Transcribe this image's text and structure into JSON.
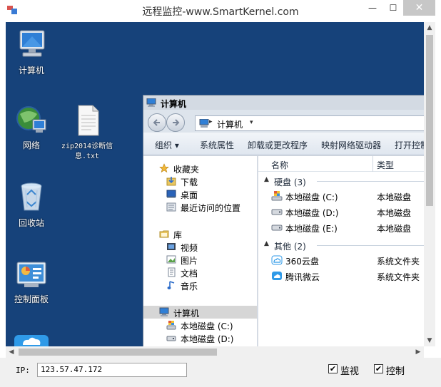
{
  "window": {
    "title": "远程监控-www.SmartKernel.com",
    "minimize_glyph": "—",
    "maximize_glyph": "☐",
    "close_glyph": "✕"
  },
  "desktop": {
    "icons": [
      {
        "label": "计算机",
        "icon": "computer-icon"
      },
      {
        "label": "网络",
        "icon": "network-icon"
      },
      {
        "label": "zip2014诊断信息.txt",
        "icon": "text-file-icon"
      },
      {
        "label": "回收站",
        "icon": "recycle-bin-icon"
      },
      {
        "label": "控制面板",
        "icon": "control-panel-icon"
      }
    ]
  },
  "explorer": {
    "title": "计算机",
    "address": "计算机",
    "toolbar": [
      "组织 ▾",
      "系统属性",
      "卸载或更改程序",
      "映射网络驱动器",
      "打开控制"
    ],
    "nav_pane": {
      "favorites": "收藏夹",
      "favorites_items": [
        "下载",
        "桌面",
        "最近访问的位置"
      ],
      "libraries": "库",
      "libraries_items": [
        "视频",
        "图片",
        "文档",
        "音乐"
      ],
      "computer": "计算机",
      "computer_items": [
        "本地磁盘 (C:)",
        "本地磁盘 (D:)"
      ]
    },
    "columns": [
      "名称",
      "类型"
    ],
    "groups": [
      {
        "label": "硬盘 (3)",
        "rows": [
          {
            "name": "本地磁盘 (C:)",
            "type": "本地磁盘"
          },
          {
            "name": "本地磁盘 (D:)",
            "type": "本地磁盘"
          },
          {
            "name": "本地磁盘 (E:)",
            "type": "本地磁盘"
          }
        ]
      },
      {
        "label": "其他 (2)",
        "rows": [
          {
            "name": "360云盘",
            "type": "系统文件夹"
          },
          {
            "name": "腾讯微云",
            "type": "系统文件夹"
          }
        ]
      }
    ]
  },
  "bottom": {
    "ip_label": "IP:",
    "ip_value": "123.57.47.172",
    "monitor_label": "监视",
    "monitor_checked": true,
    "control_label": "控制",
    "control_checked": true,
    "check_glyph": "✔"
  },
  "colors": {
    "desktop_bg": "#16427a",
    "close_button": "#c7c7c7"
  }
}
